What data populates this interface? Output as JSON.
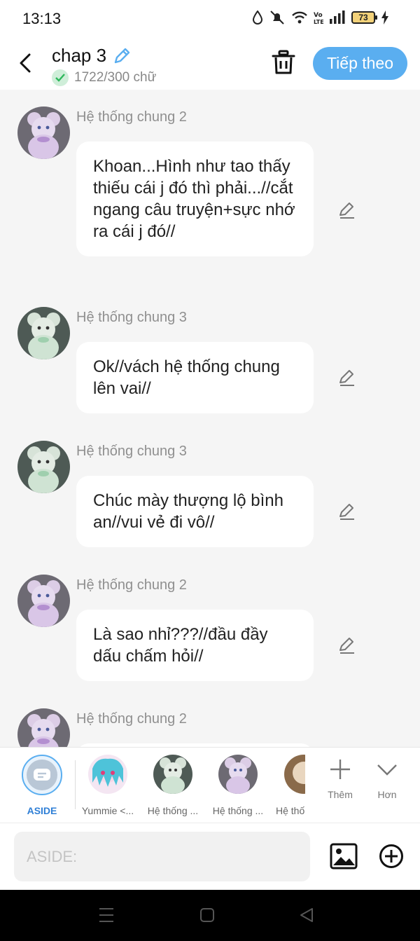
{
  "status_bar": {
    "time": "13:13",
    "battery": "73"
  },
  "header": {
    "title": "chap 3",
    "word_count": "1722/300 chữ",
    "next_label": "Tiếp theo"
  },
  "messages": [
    {
      "sender": "Hệ thống chung 2",
      "text": "Khoan...Hình như tao thấy thiếu cái j đó thì phải...//cắt ngang câu truyện+sực nhớ ra cái j đó//",
      "avatar": "purple-bear"
    },
    {
      "sender": "Hệ thống chung 3",
      "text": "Ok//vách hệ thống chung lên vai//",
      "avatar": "green-bear"
    },
    {
      "sender": "Hệ thống chung 3",
      "text": "Chúc mày thượng lộ bình an//vui vẻ đi vô//",
      "avatar": "green-bear"
    },
    {
      "sender": "Hệ thống chung 2",
      "text": "Là sao nhỉ???//đầu đầy dấu chấm hỏi//",
      "avatar": "purple-bear"
    },
    {
      "sender": "Hệ thống chung 2",
      "text": "",
      "avatar": "purple-bear"
    }
  ],
  "characters": [
    {
      "label": "ASIDE"
    },
    {
      "label": "Yummie <..."
    },
    {
      "label": "Hệ thống ..."
    },
    {
      "label": "Hệ thống ..."
    },
    {
      "label": "Hệ thố"
    }
  ],
  "tools": {
    "more": "Thêm",
    "less": "Hơn"
  },
  "input": {
    "placeholder": "ASIDE:"
  },
  "colors": {
    "accent": "#5aaef0",
    "background": "#f5f5f5",
    "aside_label": "#2f7fd6"
  }
}
